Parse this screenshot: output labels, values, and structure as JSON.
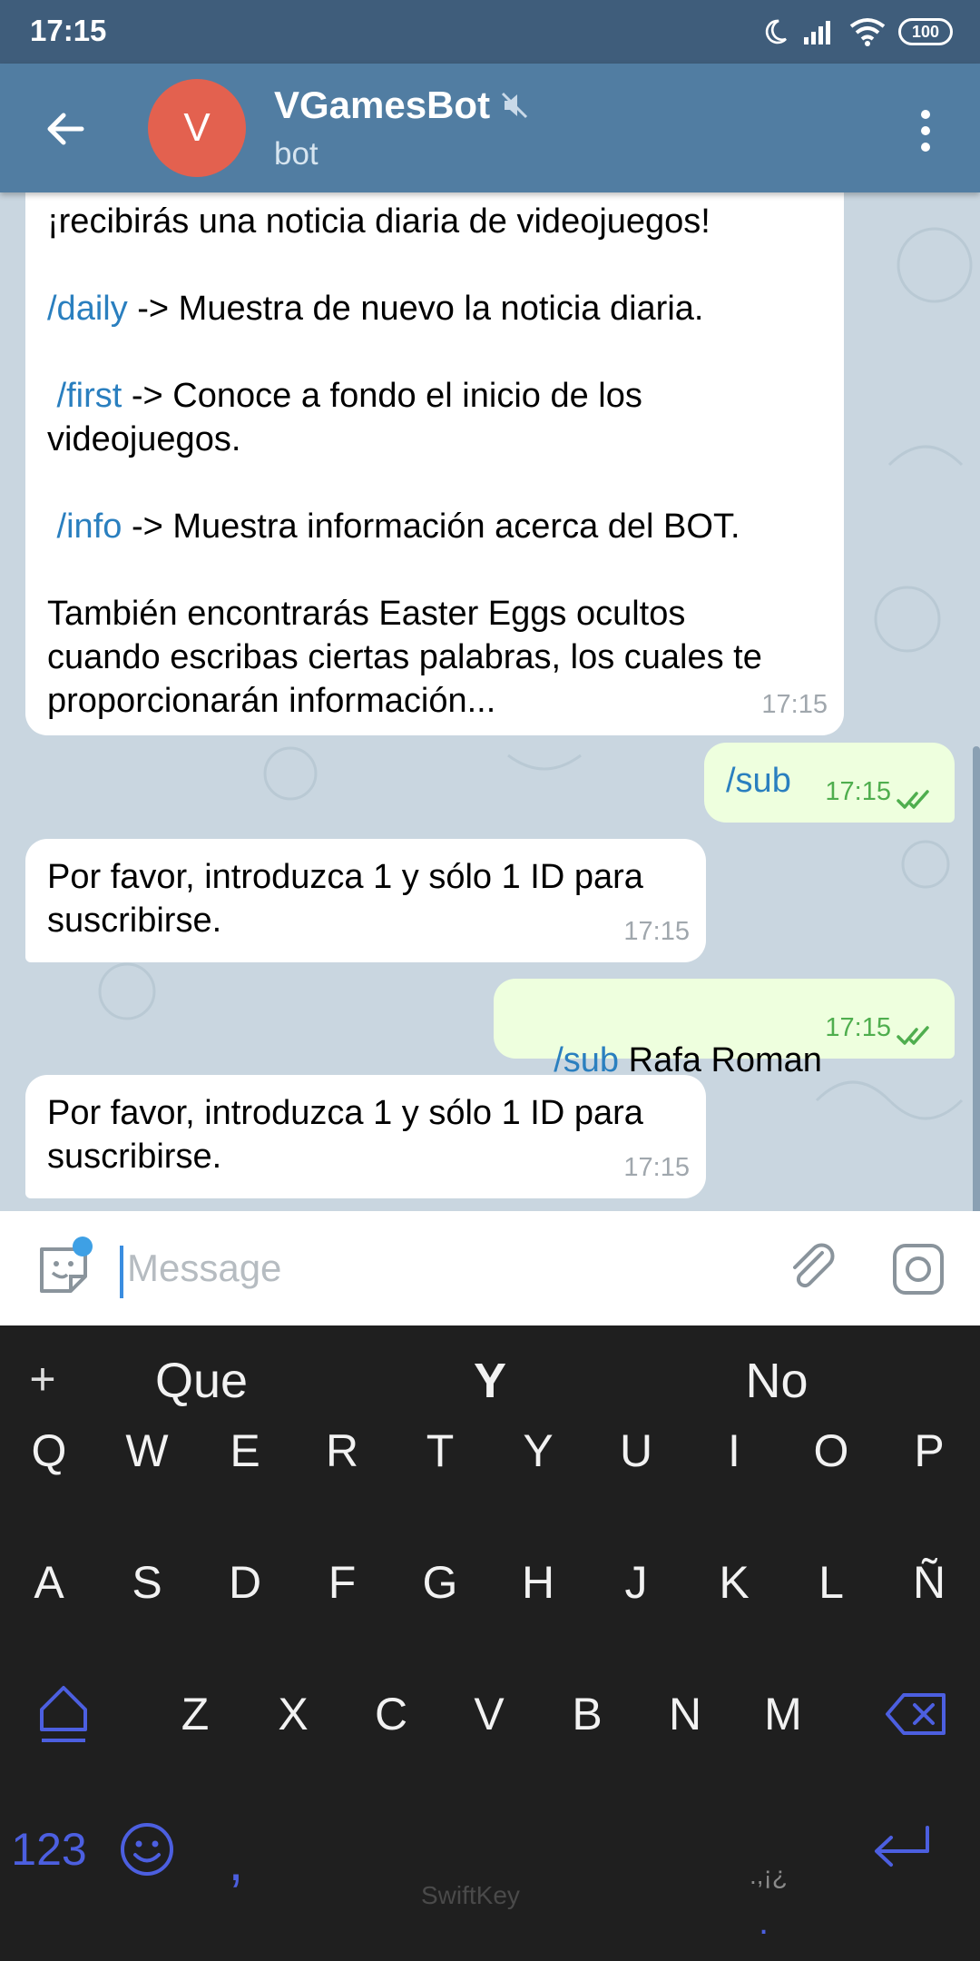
{
  "status_bar": {
    "time": "17:15",
    "battery": "100"
  },
  "header": {
    "avatar_letter": "V",
    "title": "VGamesBot",
    "subtitle": "bot"
  },
  "messages": [
    {
      "kind": "incoming",
      "lines": [
        {
          "text": "¡recibirás una noticia diaria de videojuegos!"
        },
        {
          "cmd": "/daily",
          "text": " -> Muestra de nuevo la noticia diaria."
        },
        {
          "cmd": " /first",
          "text": " -> Conoce a fondo el inicio de los"
        },
        {
          "text": "videojuegos."
        },
        {
          "cmd": " /info",
          "text": " -> Muestra información acerca del BOT."
        },
        {
          "text": "También encontrarás Easter Eggs ocultos"
        },
        {
          "text": "cuando escribas ciertas palabras, los cuales te"
        },
        {
          "text": "proporcionarán información..."
        }
      ],
      "time": "17:15"
    },
    {
      "kind": "outgoing",
      "cmd": "/sub",
      "text": "",
      "time": "17:15"
    },
    {
      "kind": "incoming",
      "lines": [
        {
          "text": "Por favor, introduzca 1 y sólo 1 ID para"
        },
        {
          "text": "suscribirse."
        }
      ],
      "time": "17:15"
    },
    {
      "kind": "outgoing",
      "cmd": "/sub",
      "text": " Rafa Roman",
      "time": "17:15"
    },
    {
      "kind": "incoming",
      "lines": [
        {
          "text": "Por favor, introduzca 1 y sólo 1 ID para"
        },
        {
          "text": "suscribirse."
        }
      ],
      "time": "17:15"
    }
  ],
  "input": {
    "placeholder": "Message"
  },
  "keyboard": {
    "plus": "+",
    "suggestions": [
      "Que",
      "Y",
      "No"
    ],
    "row1": [
      "Q",
      "W",
      "E",
      "R",
      "T",
      "Y",
      "U",
      "I",
      "O",
      "P"
    ],
    "row2": [
      "A",
      "S",
      "D",
      "F",
      "G",
      "H",
      "J",
      "K",
      "L",
      "Ñ"
    ],
    "row3": [
      "Z",
      "X",
      "C",
      "V",
      "B",
      "N",
      "M"
    ],
    "numbers_key": "123",
    "comma_key": ",",
    "punct_hint": ".,¡¿",
    "punct_key": ".",
    "brand": "SwiftKey"
  },
  "colors": {
    "header": "#517da2",
    "status_bar": "#3f5d7b",
    "avatar": "#e3614f",
    "command_link": "#2a7fbf",
    "outgoing_bubble": "#eeffde",
    "keyboard_accent": "#4c5fe0"
  }
}
